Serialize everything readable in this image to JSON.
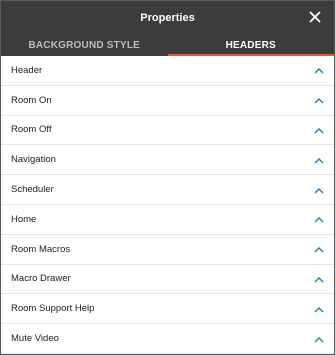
{
  "window": {
    "title": "Properties"
  },
  "tabs": [
    {
      "label": "BACKGROUND STYLE",
      "active": false
    },
    {
      "label": "HEADERS",
      "active": true
    }
  ],
  "sections": [
    {
      "label": "Header"
    },
    {
      "label": "Room On"
    },
    {
      "label": "Room Off"
    },
    {
      "label": "Navigation"
    },
    {
      "label": "Scheduler"
    },
    {
      "label": "Home"
    },
    {
      "label": "Room Macros"
    },
    {
      "label": "Macro Drawer"
    },
    {
      "label": "Room Support Help"
    },
    {
      "label": "Mute Video"
    }
  ],
  "icons": {
    "close": "close-icon",
    "expand": "chevron-up-icon"
  },
  "colors": {
    "titlebar": "#3c3c3c",
    "accent": "#e05a33",
    "chevron": "#2f7fb8"
  }
}
